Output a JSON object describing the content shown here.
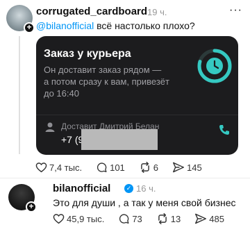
{
  "post1": {
    "username": "corrugated_cardboard",
    "time": "19 ч.",
    "mention": "@bilanofficial",
    "text": " всё настолько плохо?",
    "embed": {
      "title": "Заказ у курьера",
      "description": "Он доставит заказ рядом —\nа потом сразу к вам, привезёт\nдо 16:40",
      "courier_label": "Доставит Дмитрий Белан",
      "phone_prefix": "+7 (9"
    },
    "likes": "7,4 тыс.",
    "comments": "101",
    "reposts": "6",
    "shares": "145"
  },
  "post2": {
    "username": "bilanofficial",
    "time": "16 ч.",
    "text": "Это для души , а так у меня свой бизнес",
    "likes": "45,9 тыс.",
    "comments": "73",
    "reposts": "13",
    "shares": "485"
  },
  "icons": {
    "like": "heart-icon",
    "comment": "comment-icon",
    "repost": "repost-icon",
    "share": "send-icon",
    "verified": "verified-badge-icon",
    "clock": "clock-icon",
    "phone": "phone-icon",
    "courier": "person-icon"
  },
  "colors": {
    "accent": "#0095f6",
    "ring": "#35c9c2",
    "card_bg": "#1c1c1e"
  }
}
